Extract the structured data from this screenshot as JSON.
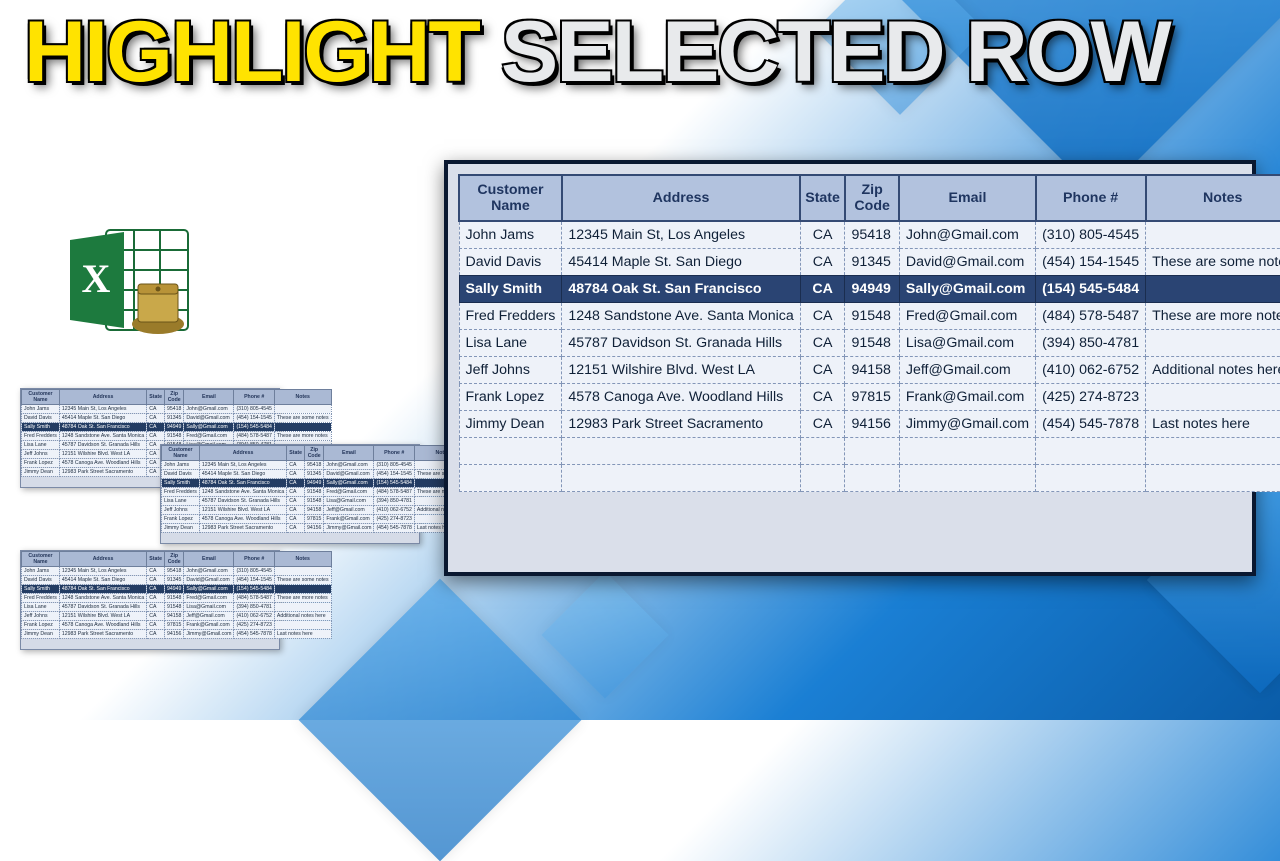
{
  "title": {
    "word1": "HIGHLIGHT",
    "word2": "SELECTED ROW"
  },
  "table": {
    "headers": [
      "Customer Name",
      "Address",
      "State",
      "Zip Code",
      "Email",
      "Phone #",
      "Notes"
    ],
    "selected_index": 2,
    "rows": [
      {
        "name": "John Jams",
        "address": "12345 Main St, Los Angeles",
        "state": "CA",
        "zip": "95418",
        "email": "John@Gmail.com",
        "phone": "(310) 805-4545",
        "notes": ""
      },
      {
        "name": "David Davis",
        "address": "45414 Maple St. San Diego",
        "state": "CA",
        "zip": "91345",
        "email": "David@Gmail.com",
        "phone": "(454) 154-1545",
        "notes": "These are some notes"
      },
      {
        "name": "Sally Smith",
        "address": "48784 Oak St. San Francisco",
        "state": "CA",
        "zip": "94949",
        "email": "Sally@Gmail.com",
        "phone": "(154) 545-5484",
        "notes": ""
      },
      {
        "name": "Fred Fredders",
        "address": "1248 Sandstone Ave. Santa Monica",
        "state": "CA",
        "zip": "91548",
        "email": "Fred@Gmail.com",
        "phone": "(484) 578-5487",
        "notes": "These are more notes"
      },
      {
        "name": "Lisa Lane",
        "address": "45787 Davidson St. Granada Hills",
        "state": "CA",
        "zip": "91548",
        "email": "Lisa@Gmail.com",
        "phone": "(394) 850-4781",
        "notes": ""
      },
      {
        "name": "Jeff Johns",
        "address": "12151 Wilshire Blvd. West LA",
        "state": "CA",
        "zip": "94158",
        "email": "Jeff@Gmail.com",
        "phone": "(410) 062-6752",
        "notes": "Additional notes here"
      },
      {
        "name": "Frank Lopez",
        "address": "4578 Canoga  Ave. Woodland Hills",
        "state": "CA",
        "zip": "97815",
        "email": "Frank@Gmail.com",
        "phone": "(425) 274-8723",
        "notes": ""
      },
      {
        "name": "Jimmy Dean",
        "address": "12983 Park Street Sacramento",
        "state": "CA",
        "zip": "94156",
        "email": "Jimmy@Gmail.com",
        "phone": "(454) 545-7878",
        "notes": "Last notes here"
      }
    ],
    "empty_rows": 2
  },
  "icon": {
    "letter": "X"
  }
}
